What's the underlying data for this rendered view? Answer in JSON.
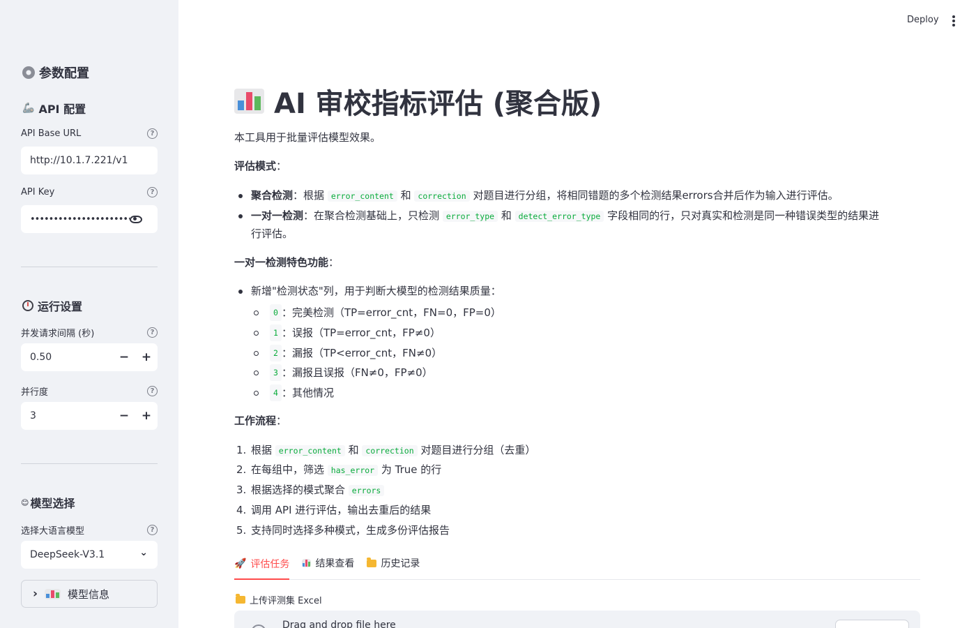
{
  "header": {
    "deploy_label": "Deploy"
  },
  "sidebar": {
    "section_params": "参数配置",
    "section_api": "API 配置",
    "api_base_url": {
      "label": "API Base URL",
      "value": "http://10.1.7.221/v1"
    },
    "api_key": {
      "label": "API Key",
      "value": "••••••••••••••••••••••••••"
    },
    "section_run": "运行设置",
    "interval": {
      "label": "并发请求间隔 (秒)",
      "value": "0.50"
    },
    "concurrency": {
      "label": "并行度",
      "value": "3"
    },
    "section_model": "模型选择",
    "model_select": {
      "label": "选择大语言模型",
      "value": "DeepSeek-V3.1"
    },
    "model_info_label": "模型信息",
    "help_glyph": "?",
    "minus": "−",
    "plus": "+",
    "chevron_down": "⌄",
    "chevron_right": "›",
    "model_icon": "😊"
  },
  "main": {
    "title": "AI 审校指标评估 (聚合版)",
    "intro": "本工具用于批量评估模型效果。",
    "mode_heading": "评估模式",
    "colon": "：",
    "and": "和",
    "mode_agg": {
      "name": "聚合检测",
      "t1": "：根据",
      "code1": "error_content",
      "code2": "correction",
      "t2": "对题目进行分组，将相同错题的多个检测结果errors合并后作为输入进行评估。"
    },
    "mode_one": {
      "name": "一对一检测",
      "t1": "：在聚合检测基础上，只检测",
      "code1": "error_type",
      "code2": "detect_error_type",
      "t2": "字段相同的行，只对真实和检测是同一种错误类型的结果进",
      "t3": "行评估。"
    },
    "feature_heading": "一对一检测特色功能",
    "feature_intro": "新增\"检测状态\"列，用于判断大模型的检测结果质量：",
    "status_list": [
      {
        "code": "0",
        "text": "：完美检测（TP=error_cnt，FN=0，FP=0）"
      },
      {
        "code": "1",
        "text": "：误报（TP=error_cnt，FP≠0）"
      },
      {
        "code": "2",
        "text": "：漏报（TP<error_cnt，FN≠0）"
      },
      {
        "code": "3",
        "text": "：漏报且误报（FN≠0，FP≠0）"
      },
      {
        "code": "4",
        "text": "：其他情况"
      }
    ],
    "workflow_heading": "工作流程",
    "workflow": {
      "s1_a": "根据",
      "s1_code1": "error_content",
      "s1_code2": "correction",
      "s1_b": "对题目进行分组（去重）",
      "s2_a": "在每组中，筛选",
      "s2_code": "has_error",
      "s2_b": "为 True 的行",
      "s3_a": "根据选择的模式聚合",
      "s3_code": "errors",
      "s4": "调用 API 进行评估，输出去重后的结果",
      "s5": "支持同时选择多种模式，生成多份评估报告"
    },
    "step_numbers": [
      "1.",
      "2.",
      "3.",
      "4.",
      "5."
    ],
    "tabs": [
      "评估任务",
      "结果查看",
      "历史记录"
    ],
    "rocket_icon": "🚀",
    "upload_label": "上传评测集 Excel",
    "dropzone_text": "Drag and drop file here"
  }
}
